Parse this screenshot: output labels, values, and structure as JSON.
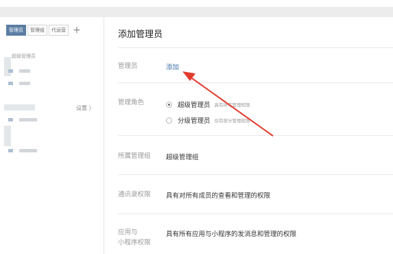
{
  "sidebar": {
    "tabs": [
      "管理员",
      "管理组",
      "代运营"
    ],
    "add_tab_symbol": "+",
    "group_title": "超级管理员",
    "settings_link": "设置 〉"
  },
  "main": {
    "title": "添加管理员",
    "admin_label": "管理员",
    "admin_add_link": "添加",
    "role_label": "管理角色",
    "role_options": [
      {
        "label": "超级管理员",
        "desc": "具有所有管理权限",
        "checked": true
      },
      {
        "label": "分级管理员",
        "desc": "仅有部分管理权限",
        "checked": false
      }
    ],
    "group_label": "所属管理组",
    "group_value": "超级管理组",
    "contacts_label": "通讯录权限",
    "contacts_value": "具有对所有成员的查看和管理的权限",
    "apps_label_line1": "应用与",
    "apps_label_line2": "小程序权限",
    "apps_value": "具有所有应用与小程序的发消息和管理的权限"
  },
  "colors": {
    "accent": "#3d6fa8",
    "active_tab": "#5b7da3",
    "arrow": "#e23a2c"
  }
}
